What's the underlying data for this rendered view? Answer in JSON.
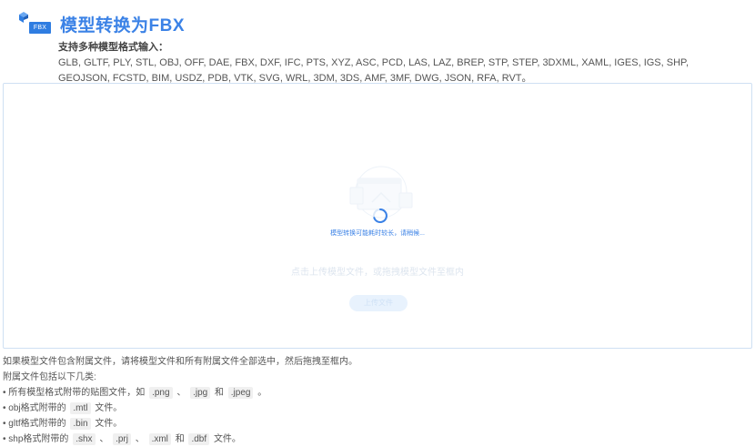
{
  "header": {
    "badge": "FBX",
    "title": "模型转换为FBX"
  },
  "formats": {
    "label": "支持多种模型格式输入：",
    "list": "GLB, GLTF, PLY, STL, OBJ, OFF, DAE, FBX, DXF, IFC, PTS, XYZ, ASC, PCD, LAS, LAZ, BREP, STP, STEP, 3DXML, XAML, IGES, IGS, SHP, GEOJSON, FCSTD, BIM, USDZ, PDB, VTK, SVG, WRL, 3DM, 3DS, AMF, 3MF, DWG, JSON, RFA, RVT。"
  },
  "dropzone": {
    "loading_text": "模型转换可能耗时较长，请稍候...",
    "hint_text": "点击上传模型文件，或拖拽模型文件至框内",
    "upload_button": "上传文件"
  },
  "notes": {
    "line1": "如果模型文件包含附属文件，请将模型文件和所有附属文件全部选中，然后拖拽至框内。",
    "line2": "附属文件包括以下几类:",
    "item1": {
      "prefix": "• 所有模型格式附带的贴图文件，如",
      "ext1": ".png",
      "sep1": "、",
      "ext2": ".jpg",
      "sep2": "和",
      "ext3": ".jpeg",
      "suffix": "。"
    },
    "item2": {
      "prefix": "• obj格式附带的",
      "ext1": ".mtl",
      "suffix": "文件。"
    },
    "item3": {
      "prefix": "• gltf格式附带的",
      "ext1": ".bin",
      "suffix": "文件。"
    },
    "item4": {
      "prefix": "• shp格式附带的",
      "ext1": ".shx",
      "sep1": "、",
      "ext2": ".prj",
      "sep2": "、",
      "ext3": ".xml",
      "sep3": "和",
      "ext4": ".dbf",
      "suffix": "文件。"
    }
  },
  "colors": {
    "accent": "#3b82e6",
    "border": "#cfe0f3"
  }
}
